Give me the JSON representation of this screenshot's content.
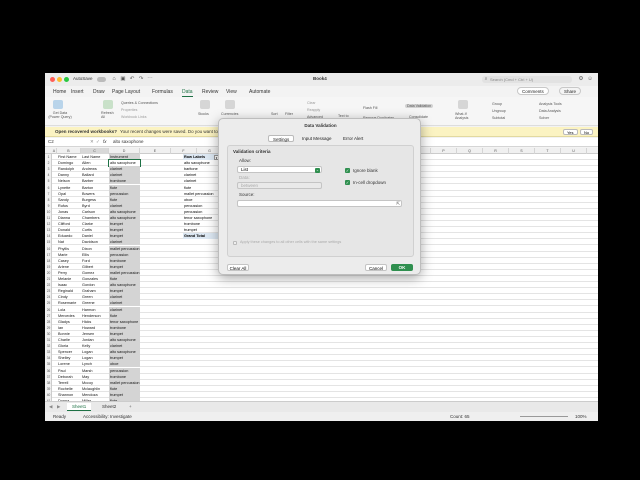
{
  "window": {
    "autosave_label": "AutoSave",
    "title": "Book4",
    "search_placeholder": "Search (Cmd + Ctrl + U)"
  },
  "tabs": [
    "Home",
    "Insert",
    "Draw",
    "Page Layout",
    "Formulas",
    "Data",
    "Review",
    "View",
    "Automate"
  ],
  "active_tab": "Data",
  "right_buttons": {
    "comments": "Comments",
    "share": "Share"
  },
  "ribbon": {
    "get_data": "Get Data (Power Query)",
    "refresh_all": "Refresh All",
    "queries": "Queries & Connections",
    "properties": "Properties",
    "workbook_links": "Workbook Links",
    "stocks": "Stocks",
    "currencies": "Currencies",
    "sort": "Sort",
    "filter": "Filter",
    "clear": "Clear",
    "reapply": "Reapply",
    "advanced": "Advanced",
    "text_to": "Text to",
    "flash_fill": "Flash Fill",
    "remove_duplicates": "Remove Duplicates",
    "data_validation": "Data Validation",
    "consolidate": "Consolidate",
    "what_if": "What-If Analysis",
    "group": "Group",
    "ungroup": "Ungroup",
    "subtotal": "Subtotal",
    "analysis_tools": "Analysis Tools",
    "data_analysis": "Data Analysis",
    "solver": "Solver"
  },
  "notification": {
    "title": "Open recovered workbooks?",
    "message": "Your recent changes were saved. Do you want to",
    "yes": "Yes",
    "no": "No"
  },
  "formula_bar": {
    "name_box": "C2",
    "fx": "fx",
    "value": "alto saxophone"
  },
  "columns": [
    "A",
    "B",
    "C",
    "D",
    "E",
    "F",
    "G",
    "H",
    "I",
    "J",
    "K",
    "L",
    "M",
    "N",
    "O",
    "P",
    "Q",
    "R",
    "S",
    "T",
    "U"
  ],
  "headers": [
    "First Name",
    "Last Name",
    "Instrument"
  ],
  "rows": [
    [
      "Domingo",
      "Allen",
      "alto saxophone"
    ],
    [
      "Randolph",
      "Andrews",
      "clarinet"
    ],
    [
      "Danny",
      "Ballard",
      "clarinet"
    ],
    [
      "Nelson",
      "Barber",
      "trombone"
    ],
    [
      "Lynette",
      "Barton",
      "flute"
    ],
    [
      "Opal",
      "Bowers",
      "percussion"
    ],
    [
      "Sandy",
      "Burgess",
      "flute"
    ],
    [
      "Rufus",
      "Byrd",
      "clarinet"
    ],
    [
      "Jonas",
      "Carlson",
      "alto saxophone"
    ],
    [
      "Dianna",
      "Chambers",
      "alto saxophone"
    ],
    [
      "Clifford",
      "Clarke",
      "trumpet"
    ],
    [
      "Donald",
      "Curtis",
      "trumpet"
    ],
    [
      "Eduardo",
      "Daniel",
      "trumpet"
    ],
    [
      "Nat",
      "Davidson",
      "clarinet"
    ],
    [
      "Phyllis",
      "Dixon",
      "mallet percussion"
    ],
    [
      "Marie",
      "Ellis",
      "percussion"
    ],
    [
      "Casey",
      "Ford",
      "trombone"
    ],
    [
      "Arlene",
      "Gilbert",
      "trumpet"
    ],
    [
      "Perry",
      "Gomez",
      "mallet percussion"
    ],
    [
      "Melanie",
      "Gonzales",
      "flute"
    ],
    [
      "Isaac",
      "Gordon",
      "alto saxophone"
    ],
    [
      "Reginald",
      "Graham",
      "trumpet"
    ],
    [
      "Cindy",
      "Green",
      "clarinet"
    ],
    [
      "Rosemarie",
      "Greene",
      "clarinet"
    ],
    [
      "Lola",
      "Harmon",
      "clarinet"
    ],
    [
      "Mercedes",
      "Henderson",
      "flute"
    ],
    [
      "Gladys",
      "Hicks",
      "tenor saxophone"
    ],
    [
      "Ian",
      "Howard",
      "trombone"
    ],
    [
      "Bonnie",
      "Jensen",
      "trumpet"
    ],
    [
      "Charlie",
      "Jordan",
      "alto saxophone"
    ],
    [
      "Gloria",
      "Kelly",
      "clarinet"
    ],
    [
      "Spencer",
      "Logan",
      "alto saxophone"
    ],
    [
      "Shelley",
      "Logan",
      "trumpet"
    ],
    [
      "Lorene",
      "Lynch",
      "oboe"
    ],
    [
      "Paul",
      "Marsh",
      "percussion"
    ],
    [
      "Deborah",
      "May",
      "trombone"
    ],
    [
      "Terrell",
      "Mccoy",
      "mallet percussion"
    ],
    [
      "Rochelle",
      "Mclaughlin",
      "flute"
    ],
    [
      "Shannon",
      "Mendoza",
      "trumpet"
    ],
    [
      "Donna",
      "Miller",
      "flute"
    ]
  ],
  "pivot": {
    "header": "Row Labels",
    "items": [
      "alto saxophone",
      "baritone",
      "clarinet",
      "clarinet",
      "flute",
      "mallet percussion",
      "oboe",
      "percussion",
      "percussion",
      "tenor saxophone",
      "trombone",
      "trumpet"
    ],
    "total": "Grand Total"
  },
  "sheet_tabs": [
    "Sheet1",
    "Sheet2"
  ],
  "status": {
    "ready": "Ready",
    "accessibility": "Accessibility: Investigate",
    "count": "Count: 65",
    "zoom": "100%"
  },
  "dialog": {
    "title": "Data Validation",
    "tabs": [
      "Settings",
      "Input Message",
      "Error Alert"
    ],
    "section": "Validation criteria",
    "allow_label": "Allow:",
    "allow_value": "List",
    "data_label": "Data:",
    "data_value": "between",
    "ignore_blank": "Ignore blank",
    "incell_dropdown": "In-cell dropdown",
    "source_label": "Source:",
    "source_value": "",
    "apply_all": "Apply these changes to all other cells with the same settings",
    "clear_all": "Clear All",
    "cancel": "Cancel",
    "ok": "OK"
  },
  "colors": {
    "excel_green": "#1e7145",
    "ok_button": "#2f8f4f",
    "notification": "#fbf3c2"
  }
}
